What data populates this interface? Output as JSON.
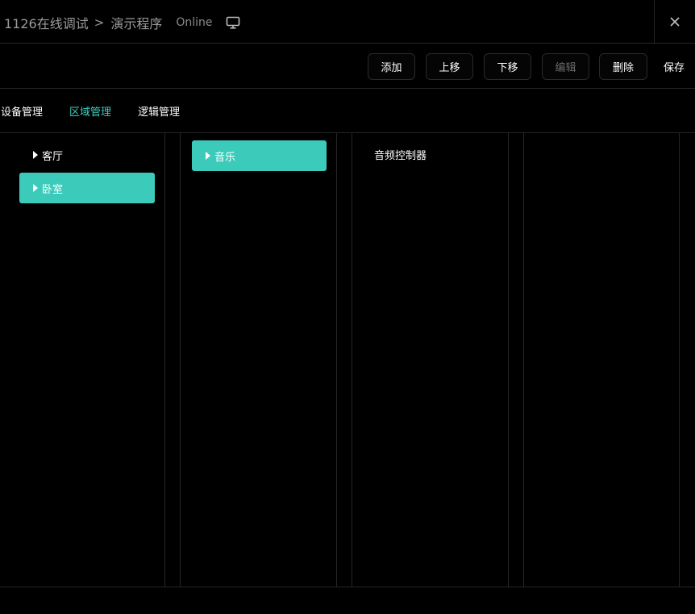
{
  "header": {
    "breadcrumb_root": "1126在线调试",
    "breadcrumb_separator": ">",
    "breadcrumb_current": "演示程序",
    "status": "Online",
    "monitor_icon": "monitor-icon",
    "close_icon": "close-icon"
  },
  "toolbar": {
    "add_label": "添加",
    "move_up_label": "上移",
    "move_down_label": "下移",
    "edit_label": "编辑",
    "delete_label": "删除",
    "save_label": "保存"
  },
  "tabs": [
    {
      "label": "设备管理",
      "active": false
    },
    {
      "label": "区域管理",
      "active": true
    },
    {
      "label": "逻辑管理",
      "active": false
    }
  ],
  "columns": {
    "areas": [
      {
        "label": "客厅",
        "selected": false
      },
      {
        "label": "卧室",
        "selected": true
      }
    ],
    "groups": [
      {
        "label": "音乐",
        "selected": true
      }
    ],
    "devices": [
      {
        "label": "音频控制器"
      }
    ]
  },
  "colors": {
    "accent": "#3ccbbb",
    "background": "#000000",
    "border": "#262626",
    "muted_text": "#9a9a9a"
  }
}
